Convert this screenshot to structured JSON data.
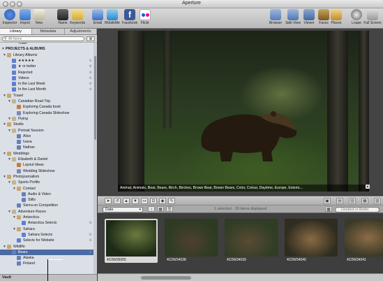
{
  "window": {
    "title": "Aperture"
  },
  "toolbar": {
    "left": [
      {
        "label": "Inspector",
        "icon": "info-icon"
      },
      {
        "label": "Import",
        "icon": "import-arrow-icon"
      },
      {
        "label": "New",
        "icon": "new-project-icon"
      },
      {
        "label": "Name",
        "icon": "name-person-icon"
      },
      {
        "label": "Keywords",
        "icon": "keywords-tag-icon"
      },
      {
        "label": "Email",
        "icon": "email-icon"
      },
      {
        "label": "MobileMe",
        "icon": "mobileme-cloud-icon"
      },
      {
        "label": "Facebook",
        "icon": "facebook-icon"
      },
      {
        "label": "Flickr",
        "icon": "flickr-icon"
      }
    ],
    "right": [
      {
        "label": "Browser",
        "icon": "browser-grid-icon"
      },
      {
        "label": "Split View",
        "icon": "split-view-icon"
      },
      {
        "label": "Viewer",
        "icon": "viewer-icon"
      },
      {
        "label": "Faces",
        "icon": "faces-icon"
      },
      {
        "label": "Places",
        "icon": "places-icon"
      },
      {
        "label": "Loupe",
        "icon": "loupe-icon"
      },
      {
        "label": "Full Screen",
        "icon": "full-screen-icon"
      }
    ]
  },
  "library_panel": {
    "tabs": [
      "Library",
      "Metadata",
      "Adjustments"
    ],
    "search_placeholder": "All Items",
    "tree": [
      {
        "label": "Trash",
        "icon": "trash",
        "level": 2
      },
      {
        "label": "PROJECTS & ALBUMS",
        "level": 0,
        "header": true
      },
      {
        "label": "Library Albums",
        "icon": "folder",
        "level": 1
      },
      {
        "label": "★★★★★",
        "icon": "smart",
        "level": 2
      },
      {
        "label": "★ or better",
        "icon": "smart",
        "level": 2
      },
      {
        "label": "Rejected",
        "icon": "smart",
        "level": 2
      },
      {
        "label": "Videos",
        "icon": "smart",
        "level": 2
      },
      {
        "label": "In the Last Week",
        "icon": "smart",
        "level": 2
      },
      {
        "label": "In the Last Month",
        "icon": "smart",
        "level": 2
      },
      {
        "label": "Travel",
        "icon": "folder",
        "level": 1
      },
      {
        "label": "Canadian Road Trip",
        "icon": "project",
        "level": 2
      },
      {
        "label": "Exploring Canada book",
        "icon": "book",
        "level": 3
      },
      {
        "label": "Exploring Canada Slideshow",
        "icon": "web",
        "level": 3
      },
      {
        "label": "Flying",
        "icon": "project",
        "level": 2
      },
      {
        "label": "Studio",
        "icon": "folder",
        "level": 1
      },
      {
        "label": "Portrait Session",
        "icon": "project",
        "level": 2
      },
      {
        "label": "Alice",
        "icon": "album",
        "level": 3
      },
      {
        "label": "Ivana",
        "icon": "album",
        "level": 3
      },
      {
        "label": "Nathan",
        "icon": "album",
        "level": 3
      },
      {
        "label": "Weddings",
        "icon": "folder",
        "level": 1
      },
      {
        "label": "Elizabeth & Daniel",
        "icon": "project",
        "level": 2
      },
      {
        "label": "Layout Ideas",
        "icon": "book",
        "level": 3
      },
      {
        "label": "Wedding Slideshow",
        "icon": "web",
        "level": 3
      },
      {
        "label": "Photojournalism",
        "icon": "folder",
        "level": 1
      },
      {
        "label": "Sports Profile",
        "icon": "project",
        "level": 2
      },
      {
        "label": "Contact",
        "icon": "folder",
        "level": 3
      },
      {
        "label": "Audio & Video",
        "icon": "album",
        "level": 4
      },
      {
        "label": "Stills",
        "icon": "album",
        "level": 4
      },
      {
        "label": "Sierra on Competition",
        "icon": "album",
        "level": 3
      },
      {
        "label": "Adventure Races",
        "icon": "project",
        "level": 2
      },
      {
        "label": "Antarctica",
        "icon": "folder",
        "level": 3
      },
      {
        "label": "Antarctica Selects",
        "icon": "smart",
        "level": 4
      },
      {
        "label": "Sahara",
        "icon": "folder",
        "level": 3
      },
      {
        "label": "Sahara Selects",
        "icon": "smart",
        "level": 4
      },
      {
        "label": "Selects for Website",
        "icon": "smart",
        "level": 3
      },
      {
        "label": "Wildlife",
        "icon": "folder",
        "level": 1
      },
      {
        "label": "Bears",
        "icon": "stack",
        "level": 2,
        "selected": true
      },
      {
        "label": "Alaska",
        "icon": "album",
        "level": 3
      },
      {
        "label": "Finland",
        "icon": "album",
        "level": 3
      }
    ],
    "footer": "Vault"
  },
  "viewer": {
    "metadata_line": "Animal, Animals, Bear, Bears, Birch, Birches, Brown Bear, Brown Bears, Color, Colour, Daytime, Europe, Exterio..."
  },
  "filter_bar": {
    "sort_value": "Date",
    "selection_text": "1 selected - 39 items displayed",
    "rating_placeholder": "Unrated or Better"
  },
  "browser": {
    "thumbnails": [
      {
        "caption": "4C0W35055",
        "selected": true
      },
      {
        "caption": "4C0W34038",
        "selected": false
      },
      {
        "caption": "4C0W34039",
        "selected": false
      },
      {
        "caption": "4C0W34040",
        "selected": false
      },
      {
        "caption": "4C0W34041",
        "selected": false
      }
    ]
  },
  "colors": {
    "selection": "#4b6aa3",
    "library_bg": "#dbe0e7",
    "viewer_bg": "#444444"
  }
}
